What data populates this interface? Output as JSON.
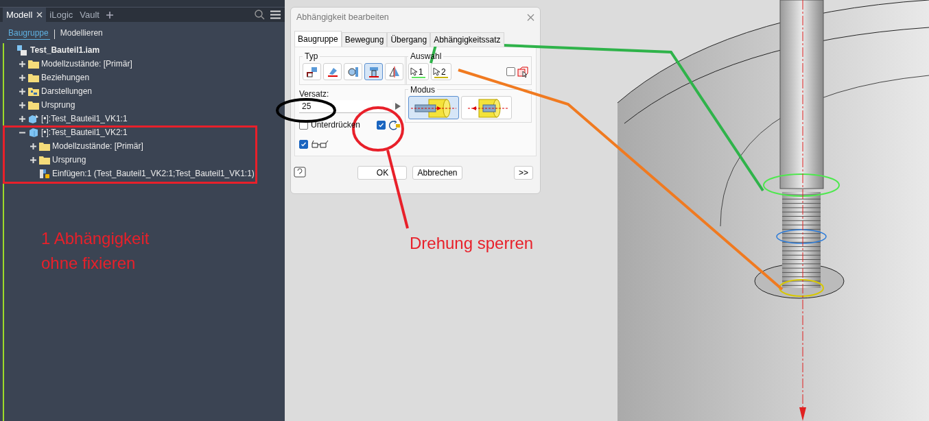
{
  "panel_tabs": [
    {
      "label": "Modell",
      "selected": true,
      "closable": true
    },
    {
      "label": "iLogic",
      "selected": false,
      "closable": false
    },
    {
      "label": "Vault",
      "selected": false,
      "closable": false
    }
  ],
  "view_toggle": [
    {
      "label": "Baugruppe",
      "selected": true
    },
    {
      "label": "Modellieren",
      "selected": false
    }
  ],
  "tree": {
    "label": "Test_Bauteil1.iam",
    "kind": "assembly",
    "children": [
      {
        "label": "Modellzustände: [Primär]",
        "kind": "folder",
        "expanded": false
      },
      {
        "label": "Beziehungen",
        "kind": "folder",
        "expanded": false
      },
      {
        "label": "Darstellungen",
        "kind": "views",
        "expanded": false
      },
      {
        "label": "Ursprung",
        "kind": "folder",
        "expanded": false
      },
      {
        "label": "[•]:Test_Bauteil1_VK1:1",
        "kind": "pinned",
        "expanded": false
      },
      {
        "label": "[•]:Test_Bauteil1_VK2:1",
        "kind": "part",
        "expanded": true,
        "children": [
          {
            "label": "Modellzustände: [Primär]",
            "kind": "folder",
            "expanded": false
          },
          {
            "label": "Ursprung",
            "kind": "folder",
            "expanded": false
          },
          {
            "label": "Einfügen:1 (Test_Bauteil1_VK2:1;Test_Bauteil1_VK1:1)",
            "kind": "constraint"
          }
        ]
      }
    ]
  },
  "dialog": {
    "title": "Abhängigkeit bearbeiten",
    "tabs": [
      {
        "label": "Baugruppe",
        "selected": true
      },
      {
        "label": "Bewegung",
        "selected": false
      },
      {
        "label": "Übergang",
        "selected": false
      },
      {
        "label": "Abhängigkeitssatz",
        "selected": false
      }
    ],
    "type_group": {
      "label": "Typ",
      "options": [
        {
          "kind": "mate",
          "selected": false
        },
        {
          "kind": "angle",
          "selected": false
        },
        {
          "kind": "tangent",
          "selected": false
        },
        {
          "kind": "insert",
          "selected": true
        },
        {
          "kind": "symmetry",
          "selected": false
        }
      ]
    },
    "selection_group": {
      "label": "Auswahl",
      "picks": [
        {
          "label": "1",
          "color": "#5ee65e"
        },
        {
          "label": "2",
          "color": "#c8b400"
        }
      ],
      "pick_part_first": false
    },
    "offset": {
      "label": "Versatz:",
      "value": "25"
    },
    "mode_group": {
      "label": "Modus",
      "options": [
        {
          "kind": "opposed",
          "selected": true
        },
        {
          "kind": "aligned",
          "selected": false
        }
      ]
    },
    "suppress": {
      "label": "Unterdrücken",
      "checked": false
    },
    "lock_rotation": {
      "checked": true
    },
    "show_preview": {
      "checked": true
    },
    "buttons": [
      "OK",
      "Abbrechen"
    ],
    "more_button": ">>"
  },
  "annotations": {
    "note": "1 Abhängigkeit\nohne fixieren",
    "callout": "Drehung sperren"
  }
}
